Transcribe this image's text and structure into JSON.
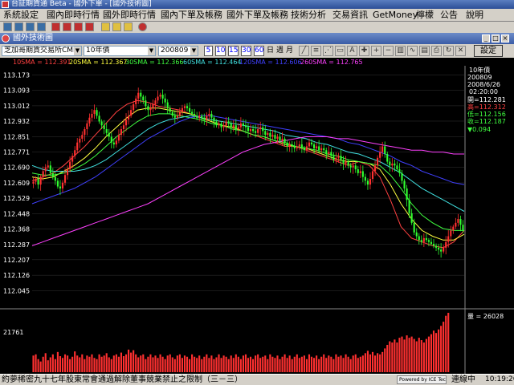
{
  "window": {
    "title": "台証期貨通 Beta - 國外下單 - [國外技術圖]",
    "inner_title": "國外技術圖"
  },
  "menu": [
    "系統設定",
    "國內即時行情",
    "國外即時行情",
    "國內下單及帳務",
    "國外下單及帳務",
    "技術分析",
    "交易資訊",
    "GetMoney",
    "檸檬",
    "公告",
    "說明"
  ],
  "controls": {
    "exchange": "芝加哥期貨交易所CME_(",
    "product": "10年債",
    "contract": "200809",
    "periods": [
      "5",
      "10",
      "15",
      "30",
      "60"
    ],
    "period_words": [
      "日",
      "週",
      "月"
    ],
    "settings_label": "設定"
  },
  "sma_labels": [
    {
      "text": "10SMA = 112.391",
      "color": "#ff4040"
    },
    {
      "text": "20SMA = 112.367",
      "color": "#ffff40"
    },
    {
      "text": "30SMA = 112.366",
      "color": "#40ff40"
    },
    {
      "text": "60SMA = 112.464",
      "color": "#40e0e0"
    },
    {
      "text": "120SMA = 112.606",
      "color": "#4040ff"
    },
    {
      "text": "260SMA = 112.765",
      "color": "#ff40ff"
    }
  ],
  "info_panel": {
    "product": "10年債",
    "contract": "200809",
    "date": "2008/6/26",
    "time": "02:20:00",
    "open": "開=112.281",
    "high": "高=112.312",
    "low": "低=112.156",
    "close": "收=112.187",
    "change": "▼0.094",
    "volume": "量 = 26028"
  },
  "y_axis_labels": [
    "113.173",
    "113.093",
    "113.012",
    "112.932",
    "112.851",
    "112.771",
    "112.690",
    "112.609",
    "112.529",
    "112.448",
    "112.368",
    "112.287",
    "112.207",
    "112.126",
    "112.045"
  ],
  "volume_axis_label": "21761",
  "status": {
    "ticker": "約夢稀密九十七年股東常會通過解除董事競業禁止之限制（三－三）",
    "powered": "Powered by ICE Tech",
    "connection": "連線中",
    "time": "10:19:26"
  },
  "chart_data": {
    "type": "candlestick",
    "ylim": [
      112.005,
      113.213
    ],
    "close_series": [
      112.615,
      112.63,
      112.6,
      112.64,
      112.67,
      112.69,
      112.7,
      112.66,
      112.64,
      112.62,
      112.59,
      112.58,
      112.61,
      112.65,
      112.68,
      112.72,
      112.75,
      112.78,
      112.82,
      112.84,
      112.86,
      112.89,
      112.92,
      112.95,
      112.97,
      112.99,
      112.96,
      112.93,
      112.91,
      112.89,
      112.87,
      112.85,
      112.82,
      112.81,
      112.83,
      112.86,
      112.89,
      112.91,
      112.94,
      112.96,
      112.99,
      113.02,
      113.05,
      113.08,
      113.06,
      113.04,
      113.01,
      112.99,
      113.0,
      113.02,
      113.04,
      113.06,
      113.07,
      113.05,
      113.03,
      113.0,
      112.98,
      112.96,
      112.95,
      112.96,
      112.98,
      113.0,
      113.01,
      113.0,
      112.98,
      112.97,
      112.96,
      112.95,
      112.96,
      112.95,
      112.94,
      112.96,
      112.97,
      112.95,
      112.93,
      112.91,
      112.92,
      112.9,
      112.91,
      112.93,
      112.92,
      112.9,
      112.91,
      112.89,
      112.9,
      112.92,
      112.91,
      112.9,
      112.88,
      112.89,
      112.88,
      112.87,
      112.89,
      112.9,
      112.88,
      112.86,
      112.87,
      112.85,
      112.86,
      112.84,
      112.85,
      112.83,
      112.84,
      112.82,
      112.8,
      112.81,
      112.8,
      112.79,
      112.8,
      112.81,
      112.79,
      112.78,
      112.8,
      112.82,
      112.81,
      112.79,
      112.8,
      112.78,
      112.79,
      112.78,
      112.76,
      112.77,
      112.75,
      112.73,
      112.74,
      112.75,
      112.73,
      112.71,
      112.72,
      112.7,
      112.69,
      112.7,
      112.68,
      112.66,
      112.67,
      112.64,
      112.62,
      112.6,
      112.63,
      112.67,
      112.7,
      112.74,
      112.77,
      112.8,
      112.76,
      112.72,
      112.7,
      112.71,
      112.7,
      112.68,
      112.66,
      112.62,
      112.58,
      112.52,
      112.45,
      112.4,
      112.35,
      112.33,
      112.31,
      112.3,
      112.32,
      112.31,
      112.3,
      112.29,
      112.28,
      112.27,
      112.26,
      112.25,
      112.27,
      112.3,
      112.33,
      112.36,
      112.38,
      112.4,
      112.42,
      112.39,
      112.36
    ],
    "volume_series": [
      0.28,
      0.3,
      0.22,
      0.18,
      0.26,
      0.32,
      0.2,
      0.25,
      0.3,
      0.22,
      0.34,
      0.27,
      0.24,
      0.3,
      0.28,
      0.22,
      0.26,
      0.35,
      0.28,
      0.25,
      0.3,
      0.22,
      0.28,
      0.26,
      0.3,
      0.24,
      0.22,
      0.3,
      0.26,
      0.28,
      0.32,
      0.25,
      0.22,
      0.28,
      0.3,
      0.26,
      0.33,
      0.27,
      0.3,
      0.38,
      0.33,
      0.37,
      0.3,
      0.25,
      0.28,
      0.3,
      0.22,
      0.26,
      0.3,
      0.25,
      0.28,
      0.24,
      0.3,
      0.26,
      0.22,
      0.28,
      0.3,
      0.25,
      0.22,
      0.28,
      0.3,
      0.24,
      0.28,
      0.26,
      0.22,
      0.3,
      0.26,
      0.24,
      0.28,
      0.22,
      0.26,
      0.3,
      0.24,
      0.28,
      0.22,
      0.25,
      0.3,
      0.24,
      0.28,
      0.26,
      0.22,
      0.28,
      0.24,
      0.3,
      0.26,
      0.22,
      0.28,
      0.3,
      0.24,
      0.26,
      0.22,
      0.28,
      0.3,
      0.24,
      0.26,
      0.28,
      0.22,
      0.3,
      0.26,
      0.24,
      0.28,
      0.22,
      0.26,
      0.3,
      0.24,
      0.28,
      0.22,
      0.26,
      0.3,
      0.24,
      0.26,
      0.28,
      0.22,
      0.3,
      0.26,
      0.24,
      0.28,
      0.22,
      0.26,
      0.3,
      0.24,
      0.28,
      0.26,
      0.22,
      0.3,
      0.26,
      0.28,
      0.24,
      0.3,
      0.26,
      0.22,
      0.28,
      0.3,
      0.24,
      0.26,
      0.28,
      0.32,
      0.36,
      0.3,
      0.34,
      0.28,
      0.32,
      0.3,
      0.34,
      0.4,
      0.46,
      0.52,
      0.5,
      0.55,
      0.5,
      0.58,
      0.6,
      0.55,
      0.62,
      0.58,
      0.6,
      0.56,
      0.52,
      0.58,
      0.54,
      0.5,
      0.56,
      0.6,
      0.64,
      0.7,
      0.66,
      0.72,
      0.78,
      0.85,
      0.95,
      1.0
    ],
    "sma_series": {
      "10SMA": [
        112.62,
        112.64,
        112.66,
        112.7,
        112.75,
        112.8,
        112.86,
        112.92,
        112.98,
        113.02,
        113.04,
        113.03,
        113.01,
        113.0,
        112.99,
        112.97,
        112.95,
        112.93,
        112.91,
        112.9,
        112.88,
        112.86,
        112.84,
        112.82,
        112.8,
        112.8,
        112.78,
        112.76,
        112.74,
        112.72,
        112.7,
        112.72,
        112.7,
        112.64,
        112.52,
        112.38,
        112.32,
        112.3,
        112.28,
        112.27,
        112.3,
        112.36
      ],
      "20SMA": [
        112.64,
        112.63,
        112.64,
        112.67,
        112.7,
        112.74,
        112.79,
        112.85,
        112.9,
        112.95,
        112.99,
        113.0,
        113.0,
        112.99,
        112.98,
        112.97,
        112.95,
        112.93,
        112.91,
        112.9,
        112.88,
        112.86,
        112.85,
        112.83,
        112.81,
        112.8,
        112.79,
        112.77,
        112.75,
        112.73,
        112.72,
        112.72,
        112.71,
        112.68,
        112.6,
        112.5,
        112.42,
        112.36,
        112.33,
        112.31,
        112.31,
        112.34
      ],
      "30SMA": [
        112.66,
        112.65,
        112.65,
        112.66,
        112.68,
        112.71,
        112.75,
        112.8,
        112.85,
        112.89,
        112.93,
        112.96,
        112.97,
        112.97,
        112.96,
        112.95,
        112.94,
        112.92,
        112.91,
        112.89,
        112.88,
        112.86,
        112.85,
        112.83,
        112.82,
        112.8,
        112.79,
        112.78,
        112.76,
        112.75,
        112.73,
        112.72,
        112.71,
        112.7,
        112.65,
        112.58,
        112.5,
        112.44,
        112.4,
        112.37,
        112.36,
        112.36
      ],
      "60SMA": [
        112.7,
        112.68,
        112.67,
        112.67,
        112.67,
        112.68,
        112.7,
        112.73,
        112.77,
        112.81,
        112.85,
        112.89,
        112.92,
        112.94,
        112.95,
        112.96,
        112.95,
        112.94,
        112.93,
        112.92,
        112.91,
        112.9,
        112.89,
        112.88,
        112.86,
        112.85,
        112.84,
        112.82,
        112.81,
        112.79,
        112.77,
        112.76,
        112.74,
        112.72,
        112.69,
        112.66,
        112.62,
        112.58,
        112.55,
        112.52,
        112.49,
        112.46
      ],
      "120SMA": [
        112.5,
        112.52,
        112.54,
        112.56,
        112.58,
        112.61,
        112.64,
        112.68,
        112.72,
        112.76,
        112.8,
        112.84,
        112.87,
        112.9,
        112.93,
        112.95,
        112.96,
        112.96,
        112.95,
        112.94,
        112.93,
        112.92,
        112.91,
        112.9,
        112.89,
        112.88,
        112.87,
        112.86,
        112.85,
        112.84,
        112.82,
        112.81,
        112.79,
        112.77,
        112.75,
        112.72,
        112.7,
        112.67,
        112.65,
        112.63,
        112.61,
        112.6
      ],
      "260SMA": [
        112.28,
        112.3,
        112.32,
        112.34,
        112.36,
        112.38,
        112.4,
        112.42,
        112.44,
        112.46,
        112.48,
        112.5,
        112.53,
        112.56,
        112.59,
        112.62,
        112.65,
        112.68,
        112.71,
        112.74,
        112.77,
        112.79,
        112.81,
        112.82,
        112.83,
        112.84,
        112.85,
        112.85,
        112.85,
        112.84,
        112.84,
        112.83,
        112.82,
        112.81,
        112.8,
        112.79,
        112.78,
        112.78,
        112.77,
        112.77,
        112.76,
        112.76
      ]
    }
  }
}
